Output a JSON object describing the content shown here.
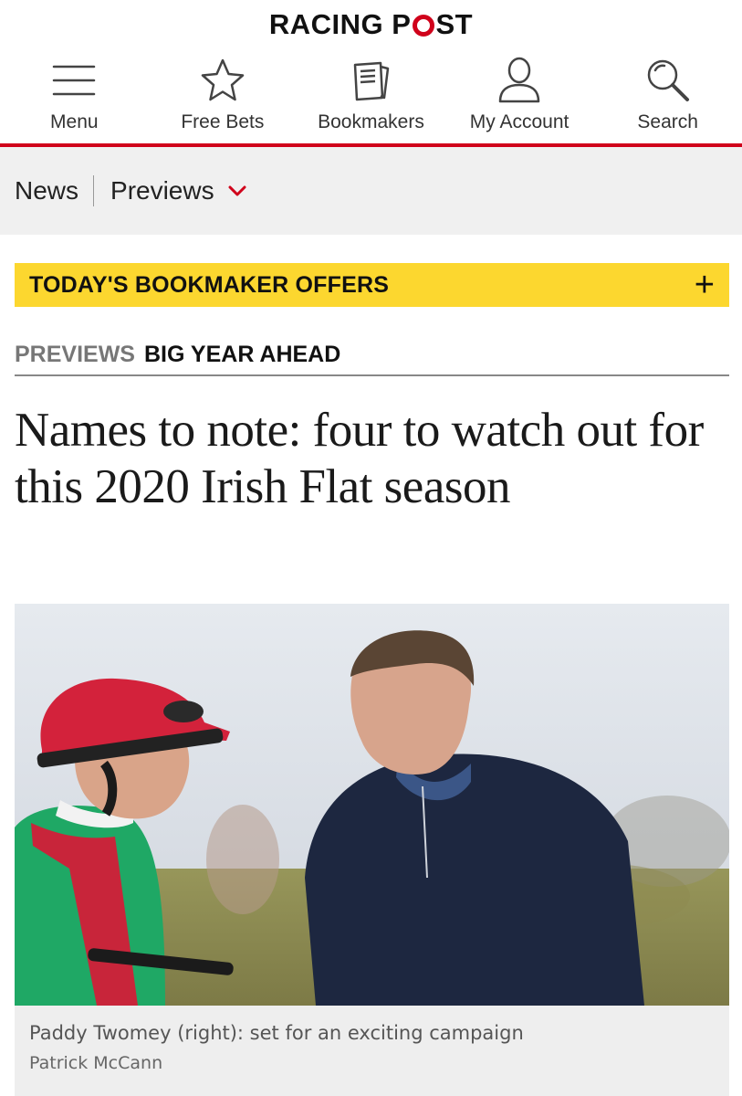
{
  "header": {
    "logo_part1": "RACING P",
    "logo_part2": "ST"
  },
  "nav": [
    {
      "label": "Menu",
      "icon": "hamburger-icon"
    },
    {
      "label": "Free Bets",
      "icon": "star-icon"
    },
    {
      "label": "Bookmakers",
      "icon": "bookmakers-icon"
    },
    {
      "label": "My Account",
      "icon": "user-icon"
    },
    {
      "label": "Search",
      "icon": "search-icon"
    }
  ],
  "breadcrumb": {
    "item1": "News",
    "item2": "Previews"
  },
  "offers": {
    "label": "TODAY'S BOOKMAKER OFFERS",
    "expand": "+"
  },
  "article": {
    "section": "PREVIEWS",
    "tag": "BIG YEAR AHEAD",
    "headline": "Names to note: four to watch out for this 2020 Irish Flat season",
    "caption": "Paddy Twomey (right): set for an exciting campaign",
    "credit": "Patrick McCann"
  },
  "colors": {
    "brand_red": "#d0021b",
    "offers_yellow": "#fcd72f"
  }
}
